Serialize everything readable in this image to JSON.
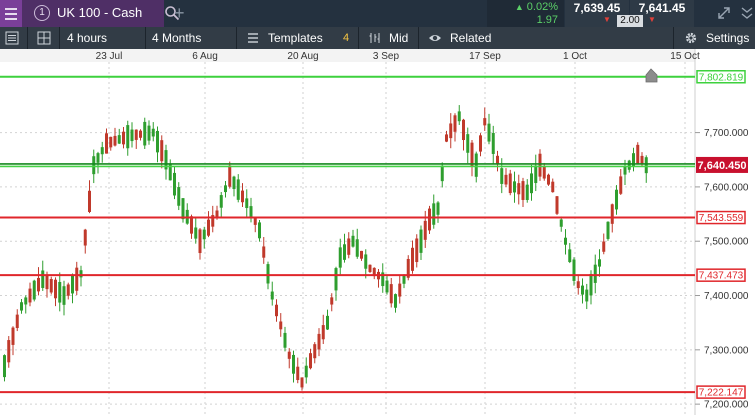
{
  "instrument": {
    "number": "1",
    "name": "UK 100 - Cash"
  },
  "quote": {
    "change_pct": "0.02%",
    "change_abs": "1.97",
    "sell": "7,639.45",
    "buy": "7,641.45",
    "spread": "2.00",
    "change_color": "#5bd068",
    "down_color": "#e2403a"
  },
  "toolbar": {
    "interval": "4 hours",
    "range": "4 Months",
    "templates_label": "Templates",
    "templates_count": "4",
    "price_type": "Mid",
    "related_label": "Related",
    "settings_label": "Settings"
  },
  "chart_data": {
    "type": "candlestick",
    "x_tick_labels": [
      "23 Jul",
      "6 Aug",
      "20 Aug",
      "3 Sep",
      "17 Sep",
      "1 Oct",
      "15 Oct"
    ],
    "y_tick_labels": [
      "7,700.000",
      "7,600.000",
      "7,500.000",
      "7,400.000",
      "7,300.000",
      "7,200.000"
    ],
    "y_ticks": [
      7700,
      7600,
      7500,
      7400,
      7300,
      7200
    ],
    "ylim": [
      7180,
      7830
    ],
    "grid": true,
    "horizontal_lines": [
      {
        "value": 7802.819,
        "label": "7,802.819",
        "color": "#3dd13d"
      },
      {
        "value": 7543.559,
        "label": "7,543.559",
        "color": "#e0262b"
      },
      {
        "value": 7437.473,
        "label": "7,437.473",
        "color": "#e0262b"
      },
      {
        "value": 7222.147,
        "label": "7,222.147",
        "color": "#e0262b"
      }
    ],
    "current_price": {
      "value": 7640.45,
      "label": "7,640.450",
      "color": "#c8102e",
      "line_color": "#16891f"
    },
    "up_color": "#2e9e2e",
    "down_color": "#c0392b",
    "path": [
      [
        0,
        7270
      ],
      [
        4,
        7380
      ],
      [
        9,
        7430
      ],
      [
        14,
        7400
      ],
      [
        18,
        7440
      ],
      [
        21,
        7640
      ],
      [
        24,
        7680
      ],
      [
        30,
        7695
      ],
      [
        35,
        7700
      ],
      [
        38,
        7650
      ],
      [
        42,
        7560
      ],
      [
        46,
        7500
      ],
      [
        50,
        7550
      ],
      [
        53,
        7620
      ],
      [
        57,
        7570
      ],
      [
        60,
        7520
      ],
      [
        63,
        7400
      ],
      [
        67,
        7290
      ],
      [
        70,
        7240
      ],
      [
        72,
        7280
      ],
      [
        76,
        7350
      ],
      [
        79,
        7470
      ],
      [
        82,
        7500
      ],
      [
        86,
        7450
      ],
      [
        89,
        7430
      ],
      [
        92,
        7390
      ],
      [
        95,
        7450
      ],
      [
        98,
        7500
      ],
      [
        100,
        7540
      ],
      [
        102,
        7560
      ],
      [
        104,
        7690
      ],
      [
        107,
        7730
      ],
      [
        109,
        7680
      ],
      [
        111,
        7640
      ],
      [
        113,
        7720
      ],
      [
        115,
        7680
      ],
      [
        117,
        7620
      ],
      [
        120,
        7600
      ],
      [
        123,
        7590
      ],
      [
        126,
        7640
      ],
      [
        129,
        7600
      ],
      [
        132,
        7500
      ],
      [
        135,
        7420
      ],
      [
        137,
        7400
      ],
      [
        140,
        7460
      ],
      [
        143,
        7550
      ],
      [
        146,
        7630
      ],
      [
        149,
        7660
      ],
      [
        151,
        7640
      ]
    ]
  }
}
